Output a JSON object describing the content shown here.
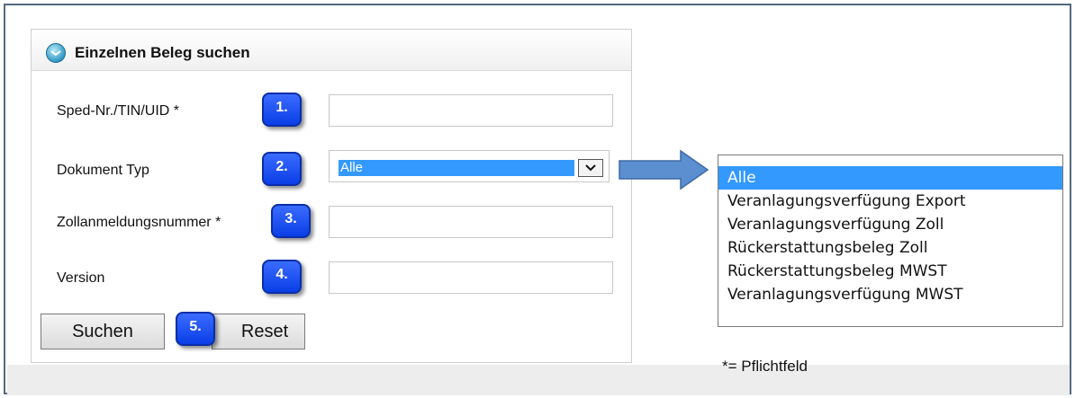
{
  "panel": {
    "title": "Einzelnen Beleg suchen"
  },
  "form": {
    "fields": [
      {
        "label": "Sped-Nr./TIN/UID *",
        "badge": "1.",
        "value": "",
        "placeholder": ""
      },
      {
        "label": "Dokument Typ",
        "badge": "2.",
        "selected": "Alle"
      },
      {
        "label": "Zollanmeldungsnummer *",
        "badge": "3.",
        "value": "",
        "placeholder": ""
      },
      {
        "label": "Version",
        "badge": "4.",
        "value": "",
        "placeholder": ""
      }
    ],
    "buttons": {
      "search_label": "Suchen",
      "reset_label": "Reset",
      "badge": "5."
    }
  },
  "dropdown": {
    "options": [
      "Alle",
      "Veranlagungsverfügung Export",
      "Veranlagungsverfügung Zoll",
      "Rückerstattungsbeleg Zoll",
      "Rückerstattungsbeleg MWST",
      "Veranlagungsverfügung MWST"
    ],
    "selected_index": 0
  },
  "footnote": "*= Pflichtfeld",
  "colors": {
    "selection": "#3399ff",
    "badge": "#1a4ff0",
    "arrow": "#5b8fd0"
  },
  "icons": {
    "panel_toggle": "chevron-down-circle-icon",
    "select_arrow": "chevron-down-icon",
    "pointer_arrow": "right-arrow-icon"
  }
}
